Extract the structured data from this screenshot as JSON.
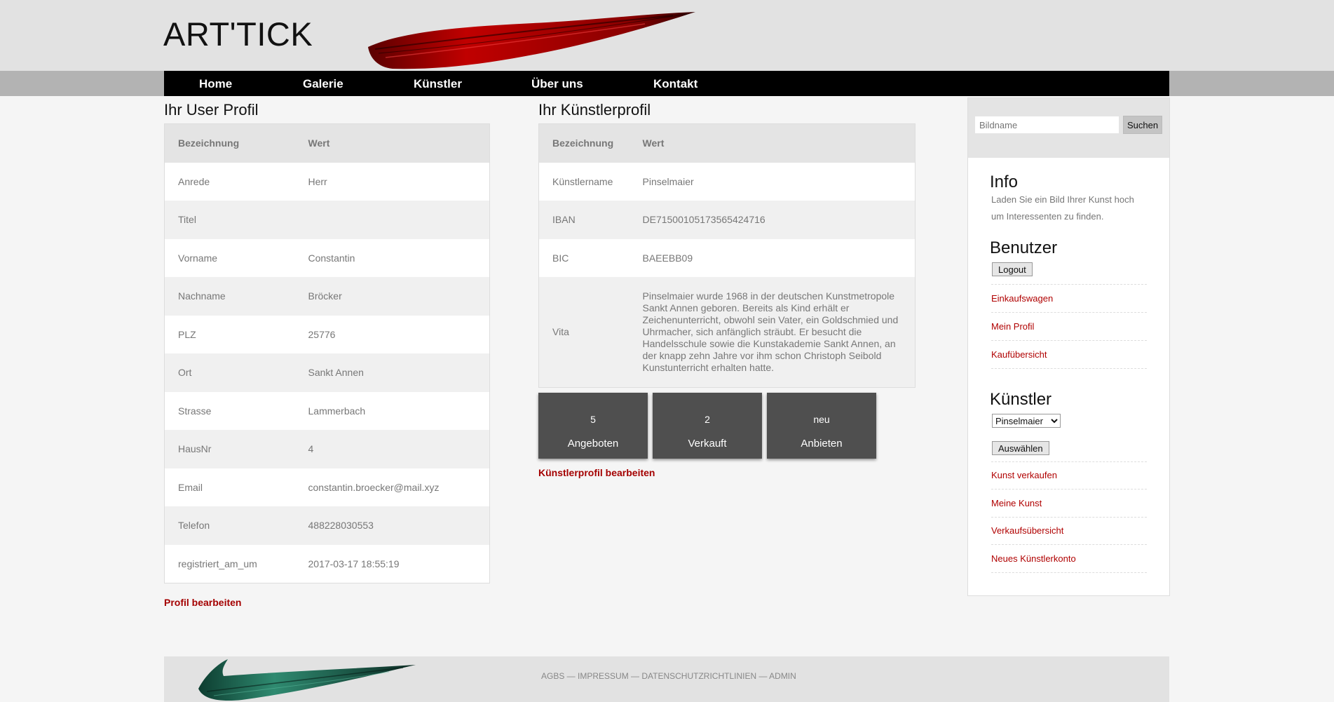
{
  "header": {
    "logo": "ART'TICK"
  },
  "nav": [
    "Home",
    "Galerie",
    "Künstler",
    "Über uns",
    "Kontakt"
  ],
  "user_profile": {
    "title": "Ihr User Profil",
    "col_label": "Bezeichnung",
    "col_value": "Wert",
    "rows": [
      [
        "Anrede",
        "Herr"
      ],
      [
        "Titel",
        ""
      ],
      [
        "Vorname",
        "Constantin"
      ],
      [
        "Nachname",
        "Bröcker"
      ],
      [
        "PLZ",
        "25776"
      ],
      [
        "Ort",
        "Sankt Annen"
      ],
      [
        "Strasse",
        "Lammerbach"
      ],
      [
        "HausNr",
        "4"
      ],
      [
        "Email",
        "constantin.broecker@mail.xyz"
      ],
      [
        "Telefon",
        "488228030553"
      ],
      [
        "registriert_am_um",
        "2017-03-17 18:55:19"
      ]
    ],
    "edit_link": "Profil bearbeiten"
  },
  "artist_profile": {
    "title": "Ihr Künstlerprofil",
    "col_label": "Bezeichnung",
    "col_value": "Wert",
    "rows": [
      [
        "Künstlername",
        "Pinselmaier"
      ],
      [
        "IBAN",
        "DE71500105173565424716"
      ],
      [
        "BIC",
        "BAEEBB09"
      ],
      [
        "Vita",
        "Pinselmaier wurde 1968 in der deutschen Kunstmetropole Sankt Annen geboren. Bereits als Kind erhält er Zeichenunterricht, obwohl sein Vater, ein Goldschmied und Uhrmacher, sich anfänglich sträubt. Er besucht die Handelsschule sowie die Kunstakademie Sankt Annen, an der knapp zehn Jahre vor ihm schon Christoph Seibold Kunstunterricht erhalten hatte."
      ]
    ],
    "stats": [
      {
        "value": "5",
        "label": "Angeboten"
      },
      {
        "value": "2",
        "label": "Verkauft"
      },
      {
        "value": "neu",
        "label": "Anbieten"
      }
    ],
    "edit_link": "Künstlerprofil bearbeiten"
  },
  "sidebar": {
    "search_placeholder": "Bildname",
    "search_button": "Suchen",
    "info_title": "Info",
    "info_text": "Laden Sie ein Bild Ihrer Kunst hoch um Interessenten zu finden.",
    "user_title": "Benutzer",
    "logout_button": "Logout",
    "user_links": [
      "Einkaufswagen",
      "Mein Profil",
      "Kaufübersicht"
    ],
    "artist_title": "Künstler",
    "artist_select": "Pinselmaier",
    "select_button": "Auswählen",
    "artist_links": [
      "Kunst verkaufen",
      "Meine Kunst",
      "Verkaufsübersicht",
      "Neues Künstlerkonto"
    ]
  },
  "footer": {
    "links": "AGBS — IMPRESSUM — DATENSCHUTZRICHTLINIEN — ADMIN"
  },
  "colors": {
    "brand_red": "#a40000",
    "nav_bg": "#000000",
    "stat_bg": "#4f4f4f",
    "brush_top": "#b30000",
    "brush_bottom": "#1a6b56"
  }
}
